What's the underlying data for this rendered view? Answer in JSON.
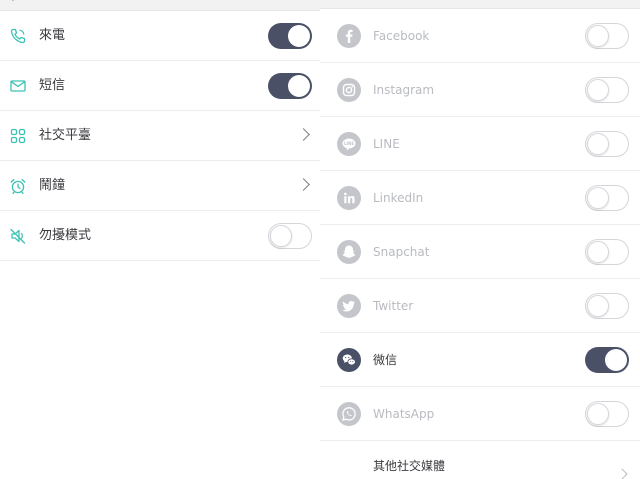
{
  "left": {
    "items": [
      {
        "label": "來電",
        "icon": "phone-icon",
        "control": "toggle",
        "on": true
      },
      {
        "label": "短信",
        "icon": "message-icon",
        "control": "toggle",
        "on": true
      },
      {
        "label": "社交平臺",
        "icon": "apps-grid-icon",
        "control": "chevron"
      },
      {
        "label": "鬧鐘",
        "icon": "alarm-clock-icon",
        "control": "chevron"
      },
      {
        "label": "勿擾模式",
        "icon": "mute-speaker-icon",
        "control": "toggle",
        "on": false
      }
    ]
  },
  "right": {
    "apps": [
      {
        "label": "Facebook",
        "icon": "facebook-icon",
        "on": false
      },
      {
        "label": "Instagram",
        "icon": "instagram-icon",
        "on": false
      },
      {
        "label": "LINE",
        "icon": "line-icon",
        "on": false
      },
      {
        "label": "LinkedIn",
        "icon": "linkedin-icon",
        "on": false
      },
      {
        "label": "Snapchat",
        "icon": "snapchat-icon",
        "on": false
      },
      {
        "label": "Twitter",
        "icon": "twitter-icon",
        "on": false
      },
      {
        "label": "微信",
        "icon": "wechat-icon",
        "on": true
      },
      {
        "label": "WhatsApp",
        "icon": "whatsapp-icon",
        "on": false
      }
    ],
    "other_label": "其他社交媒體"
  },
  "colors": {
    "toggle_on": "#4a5066",
    "icon_accent": "#3cc2b4",
    "text_primary": "#3b3b40",
    "text_muted": "#b9bbc0"
  }
}
